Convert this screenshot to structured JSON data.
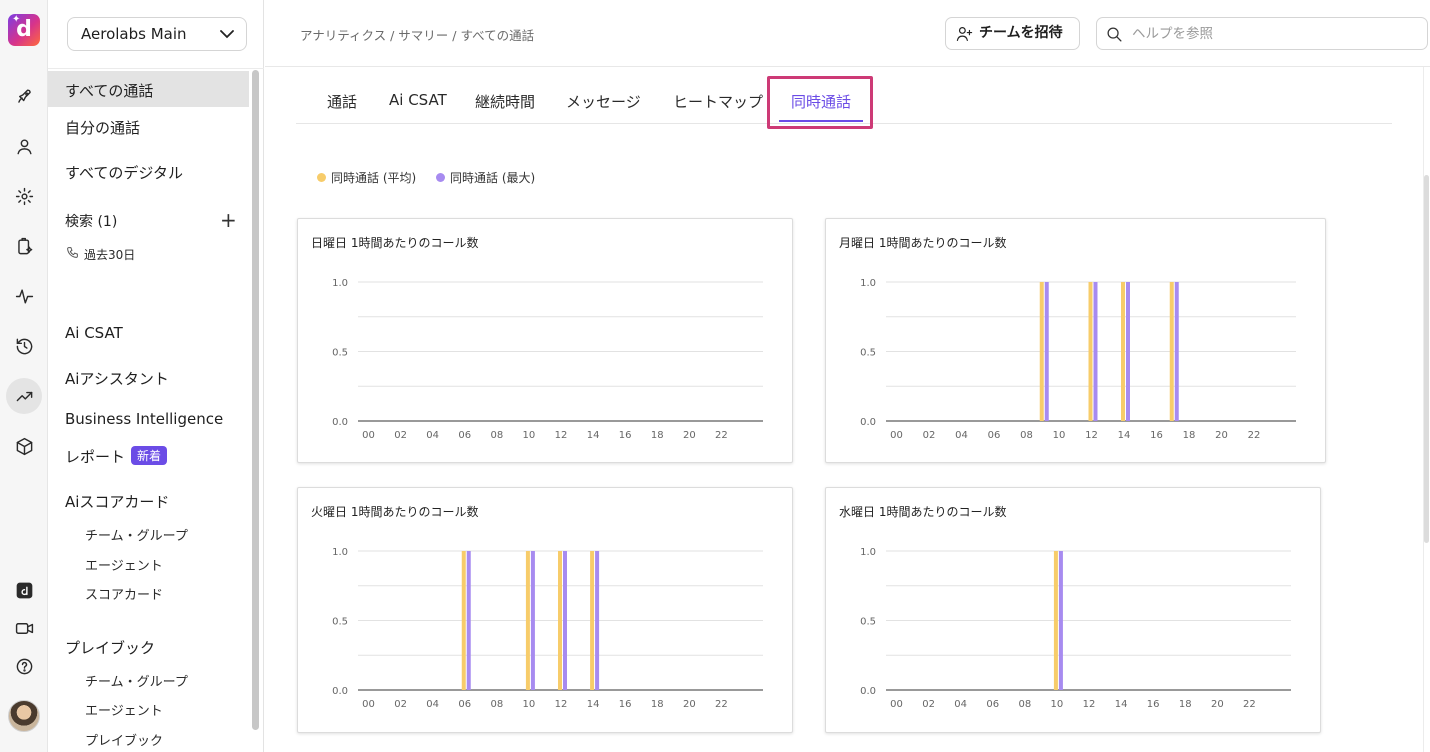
{
  "workspace": {
    "name": "Aerolabs Main"
  },
  "sidebar": {
    "items": [
      {
        "label": "すべての通話"
      },
      {
        "label": "自分の通話"
      },
      {
        "label": "すべてのデジタル"
      },
      {
        "label": "検索 (1)"
      }
    ],
    "search_filter": "過去30日",
    "sections": [
      {
        "label": "Ai CSAT"
      },
      {
        "label": "Aiアシスタント"
      },
      {
        "label": "Business Intelligence"
      },
      {
        "label": "レポート",
        "badge": "新着"
      },
      {
        "label": "Aiスコアカード",
        "children": [
          "チーム・グループ",
          "エージェント",
          "スコアカード"
        ]
      },
      {
        "label": "プレイブック",
        "children": [
          "チーム・グループ",
          "エージェント",
          "プレイブック"
        ]
      }
    ]
  },
  "header": {
    "breadcrumb": "アナリティクス / サマリー / すべての通話",
    "invite_label": "チームを招待",
    "search_placeholder": "ヘルプを参照"
  },
  "tabs": [
    {
      "label": "通話",
      "active": false
    },
    {
      "label": "Ai CSAT",
      "active": false
    },
    {
      "label": "継続時間",
      "active": false
    },
    {
      "label": "メッセージ",
      "active": false
    },
    {
      "label": "ヒートマップ",
      "active": false
    },
    {
      "label": "同時通話",
      "active": true
    }
  ],
  "legend": [
    {
      "label": "同時通話 (平均)",
      "color": "#f7cc6a"
    },
    {
      "label": "同時通話 (最大)",
      "color": "#a78bf0"
    }
  ],
  "colors": {
    "accent": "#6b4ce6",
    "avg": "#f7cc6a",
    "max": "#a78bf0",
    "highlight": "#cd3a76"
  },
  "chart_data": [
    {
      "type": "bar",
      "title": "日曜日 1時間あたりのコール数",
      "x": [
        0,
        1,
        2,
        3,
        4,
        5,
        6,
        7,
        8,
        9,
        10,
        11,
        12,
        13,
        14,
        15,
        16,
        17,
        18,
        19,
        20,
        21,
        22,
        23
      ],
      "xticks": [
        "00",
        "02",
        "04",
        "06",
        "08",
        "10",
        "12",
        "14",
        "16",
        "18",
        "20",
        "22"
      ],
      "yticks": [
        "0.0",
        "0.5",
        "1.0"
      ],
      "ylim": [
        0,
        1
      ],
      "series": [
        {
          "name": "同時通話 (平均)",
          "values": [
            0,
            0,
            0,
            0,
            0,
            0,
            0,
            0,
            0,
            0,
            0,
            0,
            0,
            0,
            0,
            0,
            0,
            0,
            0,
            0,
            0,
            0,
            0,
            0
          ]
        },
        {
          "name": "同時通話 (最大)",
          "values": [
            0,
            0,
            0,
            0,
            0,
            0,
            0,
            0,
            0,
            0,
            0,
            0,
            0,
            0,
            0,
            0,
            0,
            0,
            0,
            0,
            0,
            0,
            0,
            0
          ]
        }
      ]
    },
    {
      "type": "bar",
      "title": "月曜日 1時間あたりのコール数",
      "x": [
        0,
        1,
        2,
        3,
        4,
        5,
        6,
        7,
        8,
        9,
        10,
        11,
        12,
        13,
        14,
        15,
        16,
        17,
        18,
        19,
        20,
        21,
        22,
        23
      ],
      "xticks": [
        "00",
        "02",
        "04",
        "06",
        "08",
        "10",
        "12",
        "14",
        "16",
        "18",
        "20",
        "22"
      ],
      "yticks": [
        "0.0",
        "0.5",
        "1.0"
      ],
      "ylim": [
        0,
        1
      ],
      "series": [
        {
          "name": "同時通話 (平均)",
          "values": [
            0,
            0,
            0,
            0,
            0,
            0,
            0,
            0,
            0,
            1,
            0,
            0,
            1,
            0,
            1,
            0,
            0,
            1,
            0,
            0,
            0,
            0,
            0,
            0
          ]
        },
        {
          "name": "同時通話 (最大)",
          "values": [
            0,
            0,
            0,
            0,
            0,
            0,
            0,
            0,
            0,
            1,
            0,
            0,
            1,
            0,
            1,
            0,
            0,
            1,
            0,
            0,
            0,
            0,
            0,
            0
          ]
        }
      ]
    },
    {
      "type": "bar",
      "title": "火曜日 1時間あたりのコール数",
      "x": [
        0,
        1,
        2,
        3,
        4,
        5,
        6,
        7,
        8,
        9,
        10,
        11,
        12,
        13,
        14,
        15,
        16,
        17,
        18,
        19,
        20,
        21,
        22,
        23
      ],
      "xticks": [
        "00",
        "02",
        "04",
        "06",
        "08",
        "10",
        "12",
        "14",
        "16",
        "18",
        "20",
        "22"
      ],
      "yticks": [
        "0.0",
        "0.5",
        "1.0"
      ],
      "ylim": [
        0,
        1
      ],
      "series": [
        {
          "name": "同時通話 (平均)",
          "values": [
            0,
            0,
            0,
            0,
            0,
            0,
            1,
            0,
            0,
            0,
            1,
            0,
            1,
            0,
            1,
            0,
            0,
            0,
            0,
            0,
            0,
            0,
            0,
            0
          ]
        },
        {
          "name": "同時通話 (最大)",
          "values": [
            0,
            0,
            0,
            0,
            0,
            0,
            1,
            0,
            0,
            0,
            1,
            0,
            1,
            0,
            1,
            0,
            0,
            0,
            0,
            0,
            0,
            0,
            0,
            0
          ]
        }
      ]
    },
    {
      "type": "bar",
      "title": "水曜日 1時間あたりのコール数",
      "x": [
        0,
        1,
        2,
        3,
        4,
        5,
        6,
        7,
        8,
        9,
        10,
        11,
        12,
        13,
        14,
        15,
        16,
        17,
        18,
        19,
        20,
        21,
        22,
        23
      ],
      "xticks": [
        "00",
        "02",
        "04",
        "06",
        "08",
        "10",
        "12",
        "14",
        "16",
        "18",
        "20",
        "22"
      ],
      "yticks": [
        "0.0",
        "0.5",
        "1.0"
      ],
      "ylim": [
        0,
        1
      ],
      "series": [
        {
          "name": "同時通話 (平均)",
          "values": [
            0,
            0,
            0,
            0,
            0,
            0,
            0,
            0,
            0,
            0,
            1,
            0,
            0,
            0,
            0,
            0,
            0,
            0,
            0,
            0,
            0,
            0,
            0,
            0
          ]
        },
        {
          "name": "同時通話 (最大)",
          "values": [
            0,
            0,
            0,
            0,
            0,
            0,
            0,
            0,
            0,
            0,
            1,
            0,
            0,
            0,
            0,
            0,
            0,
            0,
            0,
            0,
            0,
            0,
            0,
            0
          ]
        }
      ]
    }
  ]
}
